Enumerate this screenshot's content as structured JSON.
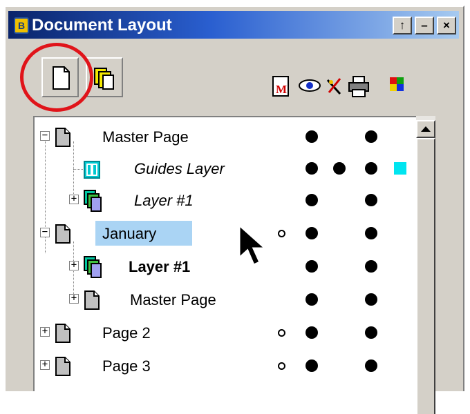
{
  "window": {
    "title": "Document Layout",
    "app_icon_glyph": "B",
    "buttons": [
      {
        "name": "pin-button",
        "glyph": "↑"
      },
      {
        "name": "minimize-button",
        "glyph": "–"
      },
      {
        "name": "close-button",
        "glyph": "×"
      }
    ]
  },
  "toolbar": {
    "tools": [
      "new-page-icon",
      "new-layer-icon"
    ],
    "highlighted_tool": "new-page-icon",
    "column_icons": [
      "master-page-icon",
      "visibility-eye-icon",
      "lock-icon",
      "print-icon",
      "color-icon"
    ]
  },
  "tree": {
    "rows": [
      {
        "label": "Master Page",
        "style": "normal",
        "icon": "page-icon",
        "expander": "−",
        "master": false,
        "eye": true,
        "lock": false,
        "print": true,
        "color": null
      },
      {
        "label": "Guides Layer",
        "style": "italic",
        "icon": "guides-icon",
        "expander": null,
        "master": false,
        "eye": true,
        "lock": true,
        "print": true,
        "color": "#00e5f0"
      },
      {
        "label": "Layer #1",
        "style": "italic",
        "icon": "layer-icon",
        "expander": "+",
        "master": false,
        "eye": true,
        "lock": false,
        "print": true,
        "color": null
      },
      {
        "label": "January",
        "style": "selected",
        "icon": "page-icon",
        "expander": "−",
        "master": true,
        "eye": true,
        "lock": false,
        "print": true,
        "color": null
      },
      {
        "label": "Layer #1",
        "style": "bold",
        "icon": "layer-icon",
        "expander": "+",
        "master": false,
        "eye": true,
        "lock": false,
        "print": true,
        "color": null
      },
      {
        "label": "Master Page",
        "style": "normal",
        "icon": "page-icon",
        "expander": "+",
        "master": false,
        "eye": true,
        "lock": false,
        "print": true,
        "color": null
      },
      {
        "label": "Page 2",
        "style": "normal",
        "icon": "page-icon",
        "expander": "+",
        "master": true,
        "eye": true,
        "lock": false,
        "print": true,
        "color": null
      },
      {
        "label": "Page 3",
        "style": "normal",
        "icon": "page-icon",
        "expander": "+",
        "master": true,
        "eye": true,
        "lock": false,
        "print": true,
        "color": null
      }
    ]
  },
  "colors": {
    "highlight_circle": "#e0141a",
    "selection": "#aad4f4",
    "guides_color": "#00e5f0"
  }
}
